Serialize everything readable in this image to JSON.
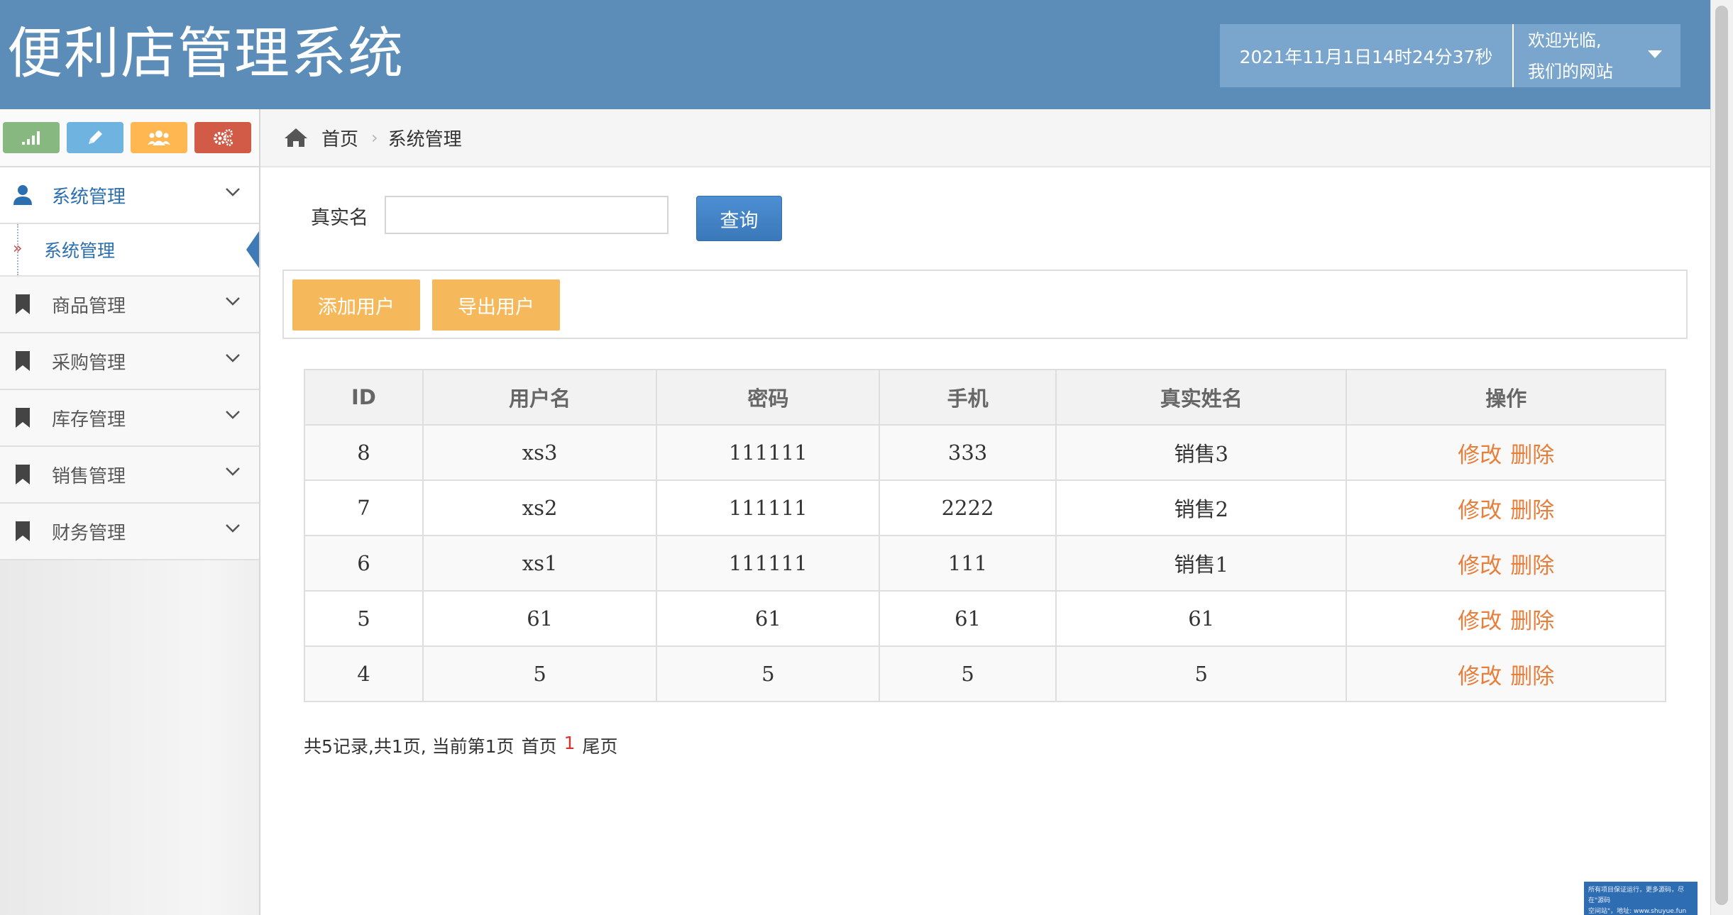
{
  "header": {
    "title": "便利店管理系统",
    "datetime": "2021年11月1日14时24分37秒",
    "welcome": "欢迎光临,",
    "site_name": "我们的网站"
  },
  "shortcuts": [
    {
      "icon": "signal-icon",
      "color": "#87b87f"
    },
    {
      "icon": "pencil-icon",
      "color": "#6fb3e0"
    },
    {
      "icon": "users-icon",
      "color": "#ffb752"
    },
    {
      "icon": "cogs-icon",
      "color": "#d15b47"
    }
  ],
  "sidebar": {
    "items": [
      {
        "label": "系统管理",
        "icon": "user-icon",
        "expanded": true,
        "sub": [
          {
            "label": "系统管理"
          }
        ]
      },
      {
        "label": "商品管理",
        "icon": "bookmark-icon"
      },
      {
        "label": "采购管理",
        "icon": "bookmark-icon"
      },
      {
        "label": "库存管理",
        "icon": "bookmark-icon"
      },
      {
        "label": "销售管理",
        "icon": "bookmark-icon"
      },
      {
        "label": "财务管理",
        "icon": "bookmark-icon"
      }
    ]
  },
  "breadcrumb": {
    "home": "首页",
    "current": "系统管理"
  },
  "search": {
    "label": "真实名",
    "value": "",
    "button": "查询"
  },
  "toolbar": {
    "add": "添加用户",
    "export": "导出用户"
  },
  "table": {
    "columns": [
      "ID",
      "用户名",
      "密码",
      "手机",
      "真实姓名",
      "操作"
    ],
    "rows": [
      [
        "8",
        "xs3",
        "111111",
        "333",
        "销售3"
      ],
      [
        "7",
        "xs2",
        "111111",
        "2222",
        "销售2"
      ],
      [
        "6",
        "xs1",
        "111111",
        "111",
        "销售1"
      ],
      [
        "5",
        "61",
        "61",
        "61",
        "61"
      ],
      [
        "4",
        "5",
        "5",
        "5",
        "5"
      ]
    ],
    "edit": "修改",
    "delete": "删除"
  },
  "pager": {
    "summary": "共5记录,共1页, 当前第1页",
    "first": "首页",
    "current": "1",
    "last": "尾页"
  },
  "watermark": {
    "line1": "所有项目保证运行，更多源码，尽在\"源码",
    "line2": "空间站\"，地址: www.shuyue.fun"
  },
  "colors": {
    "header_bg": "#5b8db8",
    "primary": "#3a78b9",
    "toolbar_btn": "#f5b95c",
    "action_link": "#e77e3a",
    "page_current": "#d9322e"
  }
}
